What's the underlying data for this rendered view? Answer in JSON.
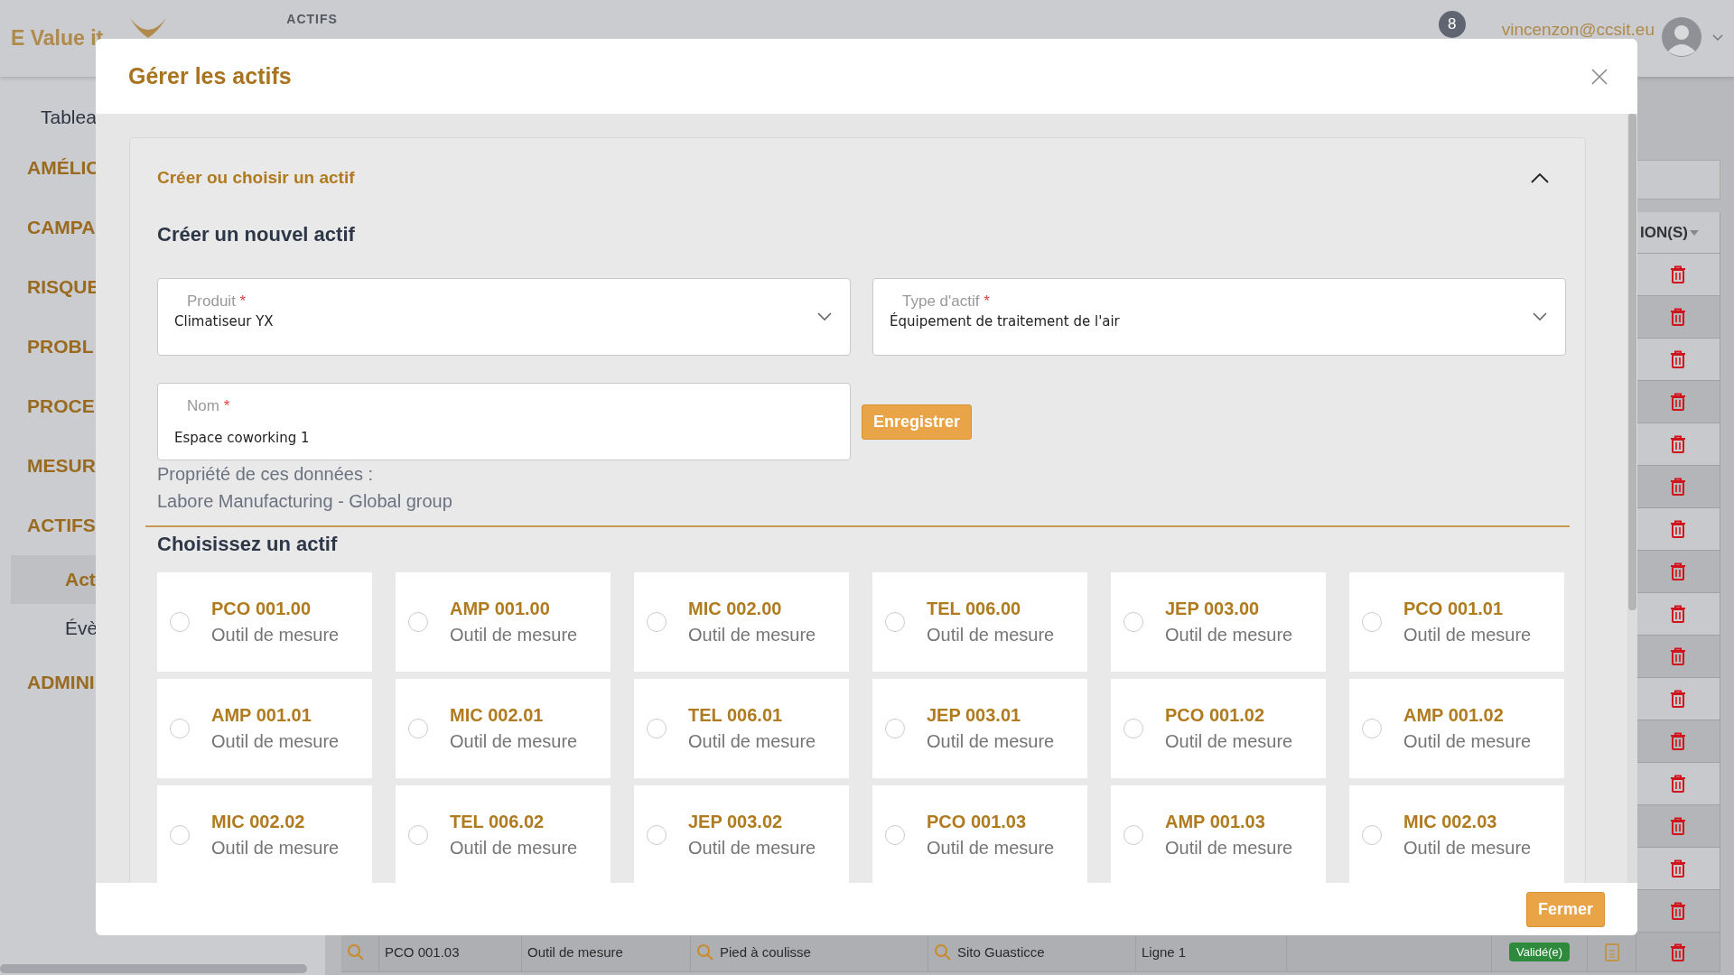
{
  "app_header": {
    "brand": "E Value it",
    "section": "ACTIFS",
    "notification_count": "8",
    "user_email": "vincenzon@ccsit.eu"
  },
  "sidebar": {
    "items": [
      {
        "label": "Tablea",
        "kind": "link",
        "selected": false
      },
      {
        "label": "AMÉLIC",
        "kind": "section",
        "selected": false
      },
      {
        "label": "CAMPA",
        "kind": "section",
        "selected": false
      },
      {
        "label": "RISQUE",
        "kind": "section",
        "selected": false
      },
      {
        "label": "PROBL",
        "kind": "section",
        "selected": false
      },
      {
        "label": "PROCE",
        "kind": "section",
        "selected": false
      },
      {
        "label": "MESUR",
        "kind": "section",
        "selected": false
      },
      {
        "label": "ACTIFS",
        "kind": "section",
        "selected": false
      },
      {
        "label": "Act",
        "kind": "subitem",
        "selected": true
      },
      {
        "label": "Évè",
        "kind": "subitem",
        "selected": false
      },
      {
        "label": "ADMINI",
        "kind": "section",
        "selected": false
      }
    ]
  },
  "table": {
    "header": "ION(S)",
    "rows": [
      {
        "kind": "covered"
      },
      {
        "kind": "covered"
      },
      {
        "kind": "covered"
      },
      {
        "kind": "covered"
      },
      {
        "kind": "covered"
      },
      {
        "kind": "covered"
      },
      {
        "kind": "covered"
      },
      {
        "kind": "covered"
      },
      {
        "kind": "covered"
      },
      {
        "kind": "covered"
      },
      {
        "kind": "covered"
      },
      {
        "kind": "covered"
      },
      {
        "kind": "covered"
      },
      {
        "kind": "covered"
      },
      {
        "kind": "covered"
      },
      {
        "kind": "covered"
      },
      {
        "kind": "full",
        "code": "PCO 001.03",
        "type": "Outil de mesure",
        "instrument": "Pied à coulisse",
        "site": "Sito Guasticce",
        "line": "Ligne 1",
        "status": "Validé(e)"
      }
    ]
  },
  "modal": {
    "title": "Gérer les actifs",
    "section_title": "Créer ou choisir un actif",
    "expanded": true,
    "create_title": "Créer un nouvel actif",
    "fields": [
      {
        "kind": "select",
        "label": "Produit",
        "mark": "*",
        "value": "Climatiseur YX"
      },
      {
        "kind": "select",
        "label": "Type d'actif",
        "mark": "*",
        "value": "Équipement de traitement de l'air"
      },
      {
        "kind": "text",
        "label": "Nom",
        "mark": "*",
        "value": "Espace coworking 1"
      }
    ],
    "save_button": "Enregistrer",
    "ownership_label": "Propriété de ces données :",
    "ownership_value": "Labore Manufacturing - Global group",
    "choose_title": "Choisissez un actif",
    "assets": [
      {
        "code": "PCO 001.00",
        "type": "Outil de mesure",
        "selected": false
      },
      {
        "code": "AMP 001.00",
        "type": "Outil de mesure",
        "selected": false
      },
      {
        "code": "MIC 002.00",
        "type": "Outil de mesure",
        "selected": false
      },
      {
        "code": "TEL 006.00",
        "type": "Outil de mesure",
        "selected": false
      },
      {
        "code": "JEP 003.00",
        "type": "Outil de mesure",
        "selected": false
      },
      {
        "code": "PCO 001.01",
        "type": "Outil de mesure",
        "selected": false
      },
      {
        "code": "AMP 001.01",
        "type": "Outil de mesure",
        "selected": false
      },
      {
        "code": "MIC 002.01",
        "type": "Outil de mesure",
        "selected": false
      },
      {
        "code": "TEL 006.01",
        "type": "Outil de mesure",
        "selected": false
      },
      {
        "code": "JEP 003.01",
        "type": "Outil de mesure",
        "selected": false
      },
      {
        "code": "PCO 001.02",
        "type": "Outil de mesure",
        "selected": false
      },
      {
        "code": "AMP 001.02",
        "type": "Outil de mesure",
        "selected": false
      },
      {
        "code": "MIC 002.02",
        "type": "Outil de mesure",
        "selected": false
      },
      {
        "code": "TEL 006.02",
        "type": "Outil de mesure",
        "selected": false
      },
      {
        "code": "JEP 003.02",
        "type": "Outil de mesure",
        "selected": false
      },
      {
        "code": "PCO 001.03",
        "type": "Outil de mesure",
        "selected": false
      },
      {
        "code": "AMP 001.03",
        "type": "Outil de mesure",
        "selected": false
      },
      {
        "code": "MIC 002.03",
        "type": "Outil de mesure",
        "selected": false
      }
    ],
    "close_button": "Fermer"
  }
}
